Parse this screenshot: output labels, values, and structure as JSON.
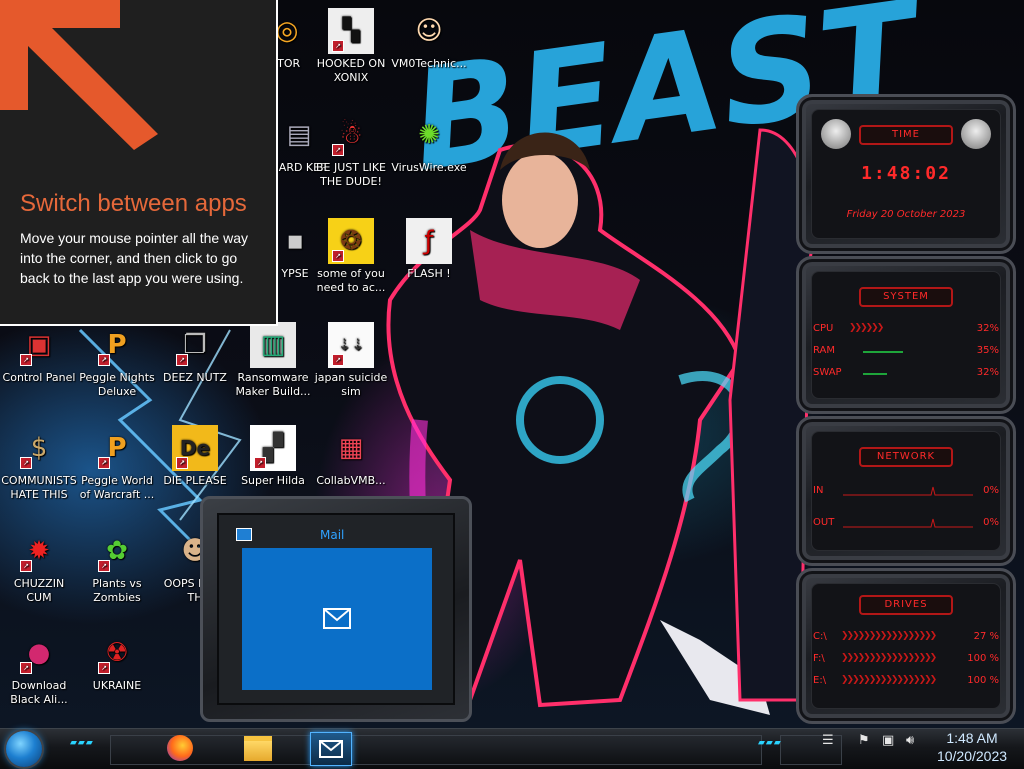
{
  "hint": {
    "title": "Switch between apps",
    "body": "Move your mouse pointer all the way into the corner, and then click to go back to the last app you were using."
  },
  "wallpaper": {
    "text": "BEAST"
  },
  "desktop_icons": [
    {
      "label": "ITOR",
      "icon": "app-icon"
    },
    {
      "label": "HOOKED ON XONIX",
      "icon": "game-icon"
    },
    {
      "label": "VM0Technic...",
      "icon": "doctor-icon"
    },
    {
      "label": "BE JUST LIKE THE DUDE!",
      "icon": "elf-icon"
    },
    {
      "label": "VirusWire.exe",
      "icon": "lime-icon"
    },
    {
      "label": "GARD KER",
      "icon": "app-icon"
    },
    {
      "label": "YPSE",
      "icon": "app-icon"
    },
    {
      "label": "some of you need to ac...",
      "icon": "beaver-icon"
    },
    {
      "label": "FLASH !",
      "icon": "flash-icon"
    },
    {
      "label": "Control Panel",
      "icon": "control-panel-icon"
    },
    {
      "label": "Peggle Nights Deluxe",
      "icon": "peggle-icon"
    },
    {
      "label": "DEEZ NUTZ",
      "icon": "window-icon"
    },
    {
      "label": "Ransomware Maker Build...",
      "icon": "monitor-icon"
    },
    {
      "label": "japan suicide sim",
      "icon": "document-icon"
    },
    {
      "label": "COMMUNISTS HATE THIS G...",
      "icon": "money-bag-icon"
    },
    {
      "label": "Peggle World of Warcraft ...",
      "icon": "peggle-icon"
    },
    {
      "label": "DIE PLEASE",
      "icon": "de-icon"
    },
    {
      "label": "Super Hilda",
      "icon": "pixel-icon"
    },
    {
      "label": "CollabVMB...",
      "icon": "collab-icon"
    },
    {
      "label": "CHUZZIN CUM",
      "icon": "chuzzle-icon"
    },
    {
      "label": "Plants vs Zombies",
      "icon": "plant-icon"
    },
    {
      "label": "OOPS B DO TH",
      "icon": "portrait-icon"
    },
    {
      "label": "Download Black Ali...",
      "icon": "alien-orb-icon"
    },
    {
      "label": "UKRAINE",
      "icon": "radiation-icon"
    }
  ],
  "time_gadget": {
    "title": "TIME",
    "time": "1:48:02",
    "date": "Friday 20 October 2023"
  },
  "system_gadget": {
    "title": "SYSTEM",
    "rows": [
      {
        "key": "CPU",
        "value": "32%"
      },
      {
        "key": "RAM",
        "value": "35%"
      },
      {
        "key": "SWAP",
        "value": "32%"
      }
    ]
  },
  "network_gadget": {
    "title": "NETWORK",
    "rows": [
      {
        "key": "IN",
        "value": "0%"
      },
      {
        "key": "OUT",
        "value": "0%"
      }
    ]
  },
  "drives_gadget": {
    "title": "DRIVES",
    "rows": [
      {
        "key": "C:\\",
        "value": "27 %"
      },
      {
        "key": "F:\\",
        "value": "100 %"
      },
      {
        "key": "E:\\",
        "value": "100 %"
      }
    ]
  },
  "mail": {
    "title": "Mail"
  },
  "taskbar": {
    "apps": [
      {
        "name": "firefox",
        "icon": "firefox-icon"
      },
      {
        "name": "file-explorer",
        "icon": "folder-icon"
      },
      {
        "name": "mail",
        "icon": "mail-icon"
      }
    ],
    "clock_time": "1:48 AM",
    "clock_date": "10/20/2023"
  },
  "colors": {
    "accent_red": "#ff2a2a",
    "accent_cyan": "#2ad4ff",
    "mail_blue": "#0b6fc8",
    "hint_orange": "#e5683a"
  }
}
